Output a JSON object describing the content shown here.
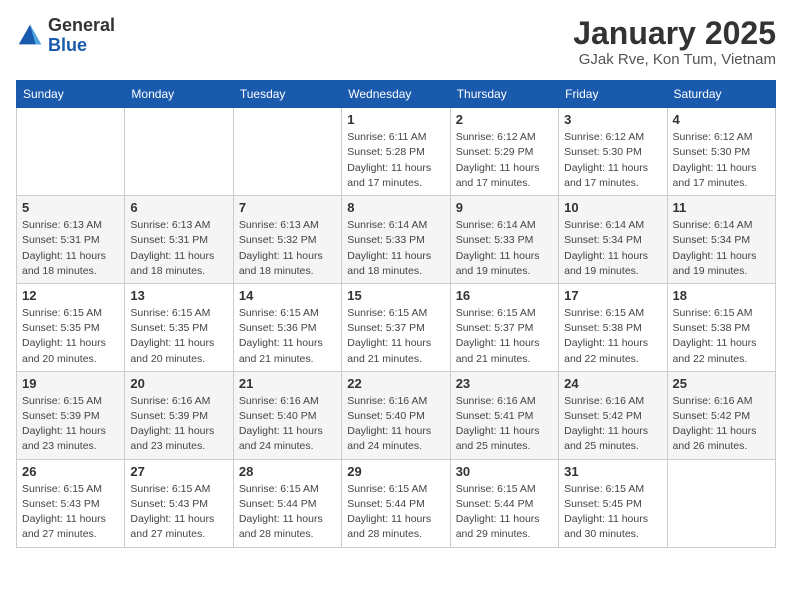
{
  "header": {
    "logo_general": "General",
    "logo_blue": "Blue",
    "month_title": "January 2025",
    "location": "GJak Rve, Kon Tum, Vietnam"
  },
  "weekdays": [
    "Sunday",
    "Monday",
    "Tuesday",
    "Wednesday",
    "Thursday",
    "Friday",
    "Saturday"
  ],
  "weeks": [
    [
      {
        "day": "",
        "info": ""
      },
      {
        "day": "",
        "info": ""
      },
      {
        "day": "",
        "info": ""
      },
      {
        "day": "1",
        "info": "Sunrise: 6:11 AM\nSunset: 5:28 PM\nDaylight: 11 hours and 17 minutes."
      },
      {
        "day": "2",
        "info": "Sunrise: 6:12 AM\nSunset: 5:29 PM\nDaylight: 11 hours and 17 minutes."
      },
      {
        "day": "3",
        "info": "Sunrise: 6:12 AM\nSunset: 5:30 PM\nDaylight: 11 hours and 17 minutes."
      },
      {
        "day": "4",
        "info": "Sunrise: 6:12 AM\nSunset: 5:30 PM\nDaylight: 11 hours and 17 minutes."
      }
    ],
    [
      {
        "day": "5",
        "info": "Sunrise: 6:13 AM\nSunset: 5:31 PM\nDaylight: 11 hours and 18 minutes."
      },
      {
        "day": "6",
        "info": "Sunrise: 6:13 AM\nSunset: 5:31 PM\nDaylight: 11 hours and 18 minutes."
      },
      {
        "day": "7",
        "info": "Sunrise: 6:13 AM\nSunset: 5:32 PM\nDaylight: 11 hours and 18 minutes."
      },
      {
        "day": "8",
        "info": "Sunrise: 6:14 AM\nSunset: 5:33 PM\nDaylight: 11 hours and 18 minutes."
      },
      {
        "day": "9",
        "info": "Sunrise: 6:14 AM\nSunset: 5:33 PM\nDaylight: 11 hours and 19 minutes."
      },
      {
        "day": "10",
        "info": "Sunrise: 6:14 AM\nSunset: 5:34 PM\nDaylight: 11 hours and 19 minutes."
      },
      {
        "day": "11",
        "info": "Sunrise: 6:14 AM\nSunset: 5:34 PM\nDaylight: 11 hours and 19 minutes."
      }
    ],
    [
      {
        "day": "12",
        "info": "Sunrise: 6:15 AM\nSunset: 5:35 PM\nDaylight: 11 hours and 20 minutes."
      },
      {
        "day": "13",
        "info": "Sunrise: 6:15 AM\nSunset: 5:35 PM\nDaylight: 11 hours and 20 minutes."
      },
      {
        "day": "14",
        "info": "Sunrise: 6:15 AM\nSunset: 5:36 PM\nDaylight: 11 hours and 21 minutes."
      },
      {
        "day": "15",
        "info": "Sunrise: 6:15 AM\nSunset: 5:37 PM\nDaylight: 11 hours and 21 minutes."
      },
      {
        "day": "16",
        "info": "Sunrise: 6:15 AM\nSunset: 5:37 PM\nDaylight: 11 hours and 21 minutes."
      },
      {
        "day": "17",
        "info": "Sunrise: 6:15 AM\nSunset: 5:38 PM\nDaylight: 11 hours and 22 minutes."
      },
      {
        "day": "18",
        "info": "Sunrise: 6:15 AM\nSunset: 5:38 PM\nDaylight: 11 hours and 22 minutes."
      }
    ],
    [
      {
        "day": "19",
        "info": "Sunrise: 6:15 AM\nSunset: 5:39 PM\nDaylight: 11 hours and 23 minutes."
      },
      {
        "day": "20",
        "info": "Sunrise: 6:16 AM\nSunset: 5:39 PM\nDaylight: 11 hours and 23 minutes."
      },
      {
        "day": "21",
        "info": "Sunrise: 6:16 AM\nSunset: 5:40 PM\nDaylight: 11 hours and 24 minutes."
      },
      {
        "day": "22",
        "info": "Sunrise: 6:16 AM\nSunset: 5:40 PM\nDaylight: 11 hours and 24 minutes."
      },
      {
        "day": "23",
        "info": "Sunrise: 6:16 AM\nSunset: 5:41 PM\nDaylight: 11 hours and 25 minutes."
      },
      {
        "day": "24",
        "info": "Sunrise: 6:16 AM\nSunset: 5:42 PM\nDaylight: 11 hours and 25 minutes."
      },
      {
        "day": "25",
        "info": "Sunrise: 6:16 AM\nSunset: 5:42 PM\nDaylight: 11 hours and 26 minutes."
      }
    ],
    [
      {
        "day": "26",
        "info": "Sunrise: 6:15 AM\nSunset: 5:43 PM\nDaylight: 11 hours and 27 minutes."
      },
      {
        "day": "27",
        "info": "Sunrise: 6:15 AM\nSunset: 5:43 PM\nDaylight: 11 hours and 27 minutes."
      },
      {
        "day": "28",
        "info": "Sunrise: 6:15 AM\nSunset: 5:44 PM\nDaylight: 11 hours and 28 minutes."
      },
      {
        "day": "29",
        "info": "Sunrise: 6:15 AM\nSunset: 5:44 PM\nDaylight: 11 hours and 28 minutes."
      },
      {
        "day": "30",
        "info": "Sunrise: 6:15 AM\nSunset: 5:44 PM\nDaylight: 11 hours and 29 minutes."
      },
      {
        "day": "31",
        "info": "Sunrise: 6:15 AM\nSunset: 5:45 PM\nDaylight: 11 hours and 30 minutes."
      },
      {
        "day": "",
        "info": ""
      }
    ]
  ]
}
